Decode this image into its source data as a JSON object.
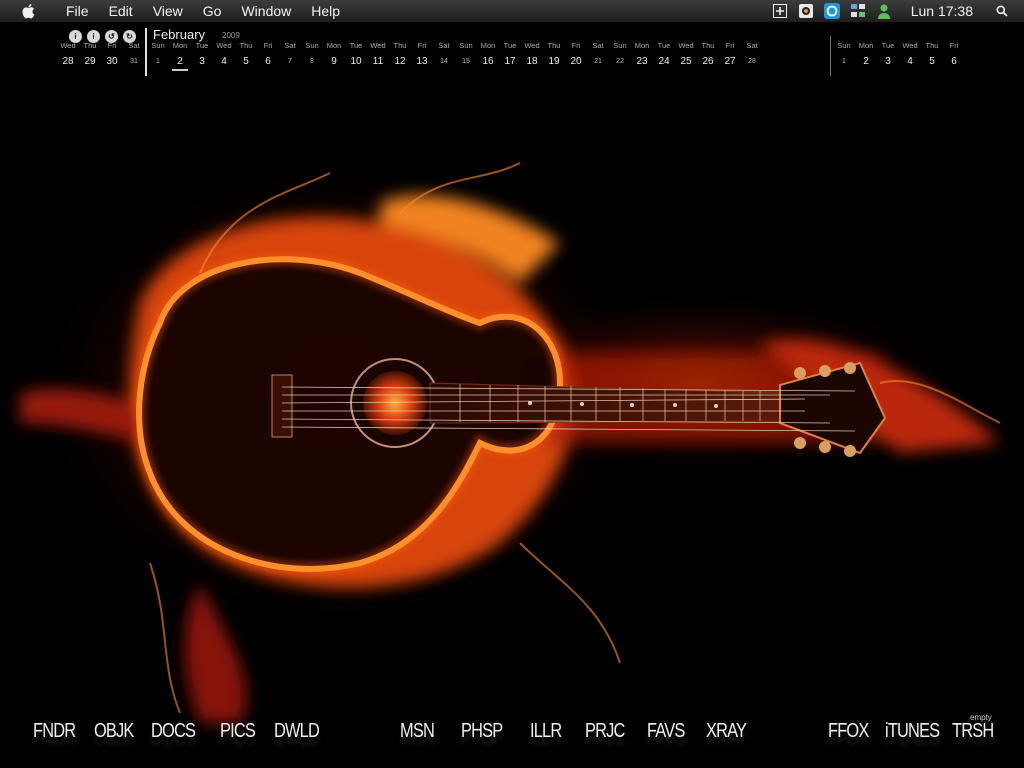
{
  "menubar": {
    "items": [
      "File",
      "Edit",
      "View",
      "Go",
      "Window",
      "Help"
    ],
    "clock": "Lun 17:38"
  },
  "calendar": {
    "month": "February",
    "year": "2009",
    "prev_days": [
      {
        "dow": "Wed",
        "num": "28"
      },
      {
        "dow": "Thu",
        "num": "29"
      },
      {
        "dow": "Fri",
        "num": "30"
      },
      {
        "dow": "Sat",
        "num": "31"
      }
    ],
    "days": [
      {
        "dow": "Sun",
        "num": "1"
      },
      {
        "dow": "Mon",
        "num": "2"
      },
      {
        "dow": "Tue",
        "num": "3"
      },
      {
        "dow": "Wed",
        "num": "4"
      },
      {
        "dow": "Thu",
        "num": "5"
      },
      {
        "dow": "Fri",
        "num": "6"
      },
      {
        "dow": "Sat",
        "num": "7"
      },
      {
        "dow": "Sun",
        "num": "8"
      },
      {
        "dow": "Mon",
        "num": "9"
      },
      {
        "dow": "Tue",
        "num": "10"
      },
      {
        "dow": "Wed",
        "num": "11"
      },
      {
        "dow": "Thu",
        "num": "12"
      },
      {
        "dow": "Fri",
        "num": "13"
      },
      {
        "dow": "Sat",
        "num": "14"
      },
      {
        "dow": "Sun",
        "num": "15"
      },
      {
        "dow": "Mon",
        "num": "16"
      },
      {
        "dow": "Tue",
        "num": "17"
      },
      {
        "dow": "Wed",
        "num": "18"
      },
      {
        "dow": "Thu",
        "num": "19"
      },
      {
        "dow": "Fri",
        "num": "20"
      },
      {
        "dow": "Sat",
        "num": "21"
      },
      {
        "dow": "Sun",
        "num": "22"
      },
      {
        "dow": "Mon",
        "num": "23"
      },
      {
        "dow": "Tue",
        "num": "24"
      },
      {
        "dow": "Wed",
        "num": "25"
      },
      {
        "dow": "Thu",
        "num": "26"
      },
      {
        "dow": "Fri",
        "num": "27"
      },
      {
        "dow": "Sat",
        "num": "28"
      }
    ],
    "next_days": [
      {
        "dow": "Sun",
        "num": "1"
      },
      {
        "dow": "Mon",
        "num": "2"
      },
      {
        "dow": "Tue",
        "num": "3"
      },
      {
        "dow": "Wed",
        "num": "4"
      },
      {
        "dow": "Thu",
        "num": "5"
      },
      {
        "dow": "Fri",
        "num": "6"
      }
    ],
    "today": "2"
  },
  "dock": {
    "left": [
      "FNDR",
      "OBJK",
      "DOCS",
      "PICS",
      "DWLD"
    ],
    "middle": [
      "MSN",
      "PHSP",
      "ILLR",
      "PRJC",
      "FAVS",
      "XRAY"
    ],
    "right": [
      "FFOX",
      "iTUNES",
      "TRSH"
    ],
    "trash_status": "empty"
  },
  "icons": {
    "apple": "apple-icon",
    "status": [
      "add-icon",
      "webcam-icon",
      "sync-icon",
      "network-icon",
      "user-icon"
    ],
    "spotlight": "spotlight-search-icon"
  }
}
